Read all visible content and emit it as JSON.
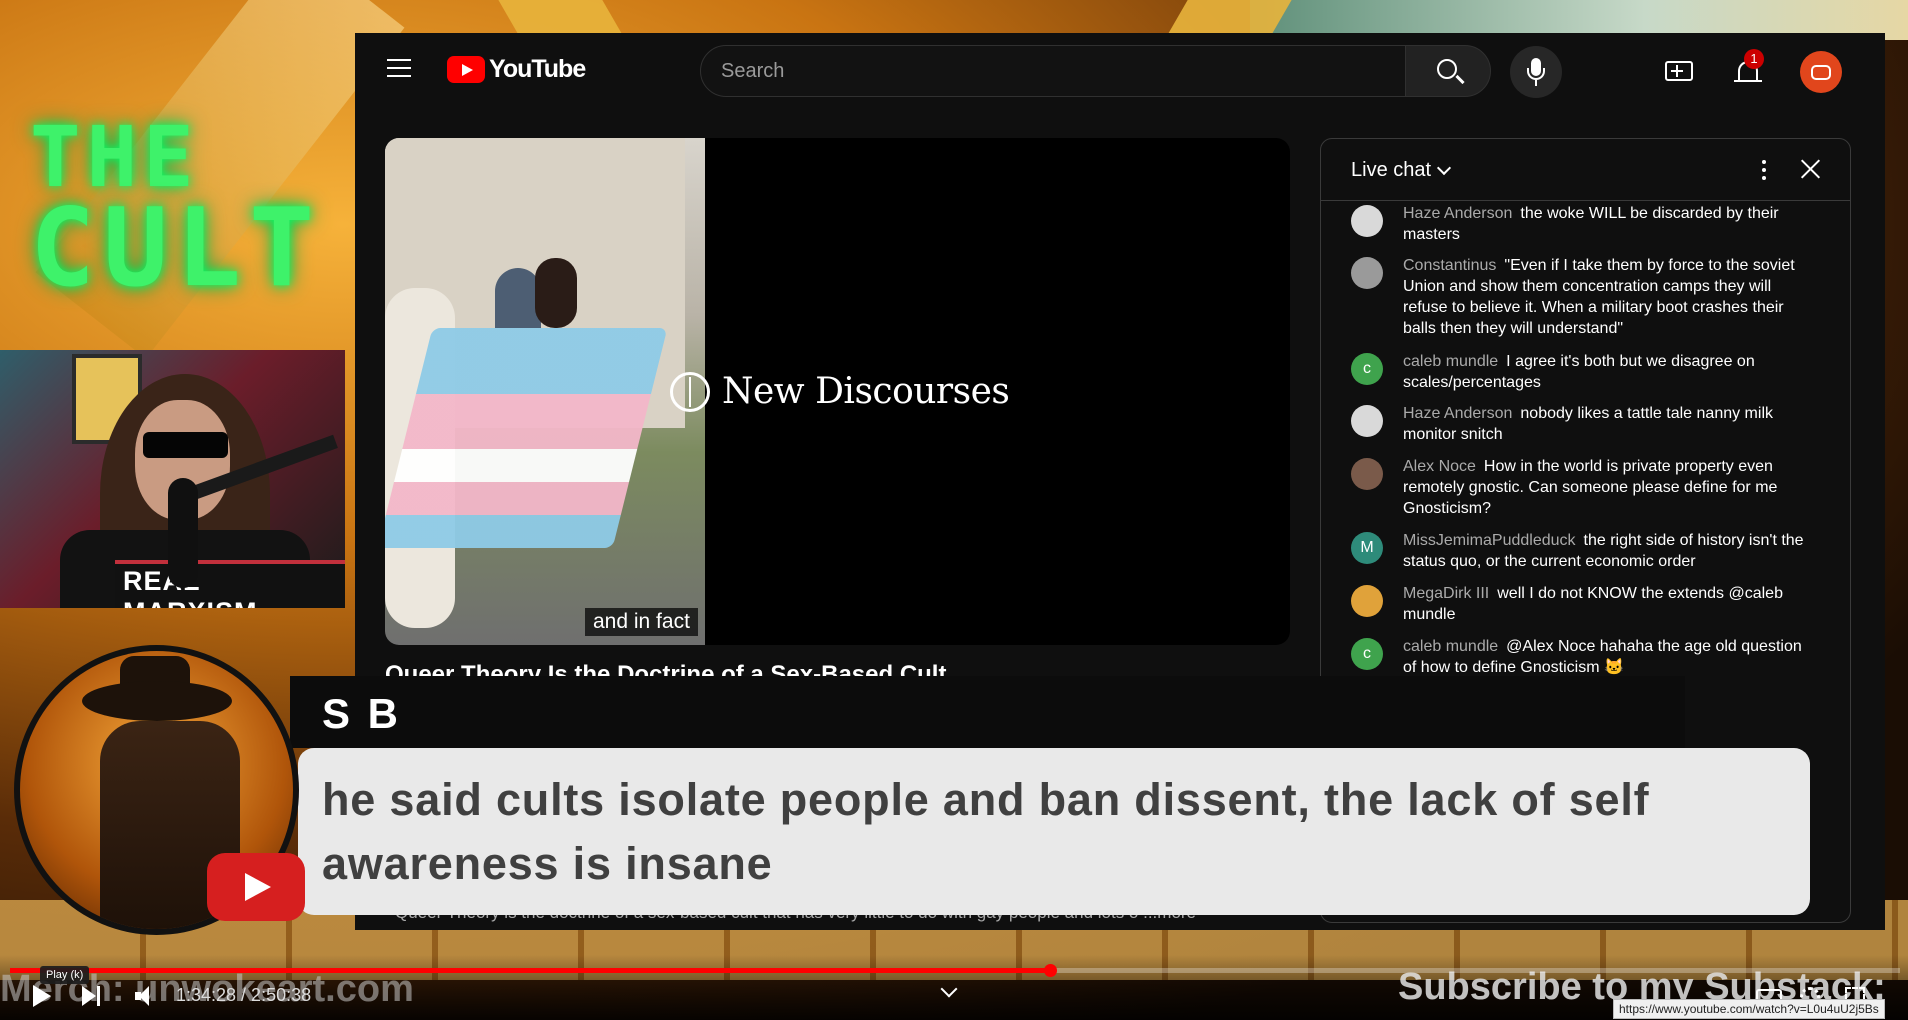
{
  "overlay_logo": {
    "line1": "THE",
    "line2": "CULT"
  },
  "webcam": {
    "shirt_text": "REAL MARXISM"
  },
  "header": {
    "logo_text": "YouTube",
    "search_placeholder": "Search",
    "notification_count": "1",
    "icons": [
      "menu-icon",
      "youtube-logo-icon",
      "search-icon",
      "microphone-icon",
      "create-icon",
      "bell-icon",
      "avatar"
    ]
  },
  "video": {
    "brand_text": "New Discourses",
    "caption": "and in fact",
    "title": "Queer Theory Is the Doctrine of a Sex-Based Cult",
    "description": "Queer Theory is the doctrine of a sex-based cult that has very little to do with gay people and lots o ...more"
  },
  "chat": {
    "title": "Live chat",
    "messages": [
      {
        "author": "Haze Anderson",
        "text": "the woke WILL be discarded by their masters",
        "avatar_initial": "",
        "avatar_color": "#d9d9d9"
      },
      {
        "author": "Constantinus",
        "text": "\"Even if I take them by force to the soviet Union and show them concentration camps they will refuse to believe it. When a military boot crashes their balls then they will understand\"",
        "avatar_initial": "",
        "avatar_color": "#9a9a9a"
      },
      {
        "author": "caleb mundle",
        "text": "I agree it's both but we disagree on scales/percentages",
        "avatar_initial": "c",
        "avatar_color": "#3fa34d"
      },
      {
        "author": "Haze Anderson",
        "text": "nobody likes a tattle tale nanny milk monitor snitch",
        "avatar_initial": "",
        "avatar_color": "#d9d9d9"
      },
      {
        "author": "Alex Noce",
        "text": "How in the world is private property even remotely gnostic. Can someone please define for me Gnosticism?",
        "avatar_initial": "",
        "avatar_color": "#7a5a4a"
      },
      {
        "author": "MissJemimaPuddleduck",
        "text": "the right side of history isn't the status quo, or the current economic order",
        "avatar_initial": "M",
        "avatar_color": "#2e8b7a"
      },
      {
        "author": "MegaDirk III",
        "text": "well I do not KNOW the extends @caleb mundle",
        "avatar_initial": "",
        "avatar_color": "#e0a23a"
      },
      {
        "author": "caleb mundle",
        "text": "@Alex Noce hahaha the age old question of how to define Gnosticism 🐱",
        "avatar_initial": "c",
        "avatar_color": "#3fa34d"
      }
    ]
  },
  "superchat": {
    "name": "S B",
    "comment": "he said cults isolate people and ban dissent, the lack of self awareness is insane"
  },
  "player": {
    "progress": 0.55,
    "time": "1:34:28 / 2:50:38",
    "tooltip": "Play (k)",
    "merch_text": "Merch: unwokeart.com",
    "subscribe_text": "Subscribe to my Substack:",
    "url_tip": "https://www.youtube.com/watch?v=L0u4uU2j5Bs"
  }
}
